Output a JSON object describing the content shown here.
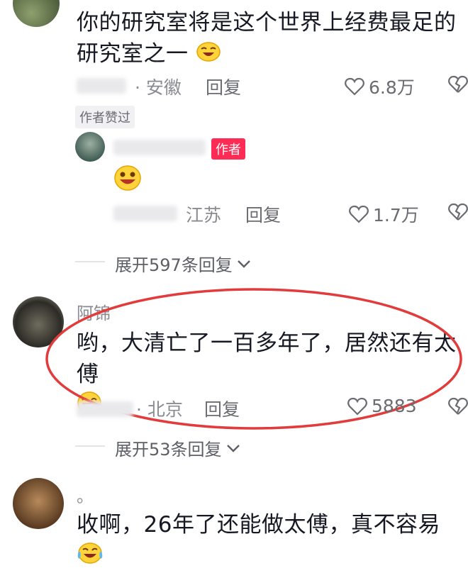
{
  "comment1": {
    "text": "你的研究室将是这个世界上经费最足的研究室之一",
    "location": "安徽",
    "reply_label": "回复",
    "likes": "6.8万",
    "liked_by_author": "作者赞过"
  },
  "reply1": {
    "author_tag": "作者",
    "location": "江苏",
    "reply_label": "回复",
    "likes": "1.7万"
  },
  "expand1": {
    "label": "展开597条回复"
  },
  "comment2": {
    "name": "阿锦",
    "text": "哟，大清亡了一百多年了，居然还有太傅",
    "location": "北京",
    "reply_label": "回复",
    "likes": "5883"
  },
  "expand2": {
    "label": "展开53条回复"
  },
  "comment3": {
    "name": "。",
    "text": "收啊，26年了还能做太傅，真不容易"
  },
  "colors": {
    "highlight": "#e23b3b",
    "author_tag": "#fe2c55",
    "meta_gray": "#8a8b91"
  },
  "icons": [
    "heart-icon",
    "broken-heart-icon",
    "chevron-down-icon",
    "laughing-emoji",
    "smile-emoji",
    "crying-laughing-emoji"
  ]
}
